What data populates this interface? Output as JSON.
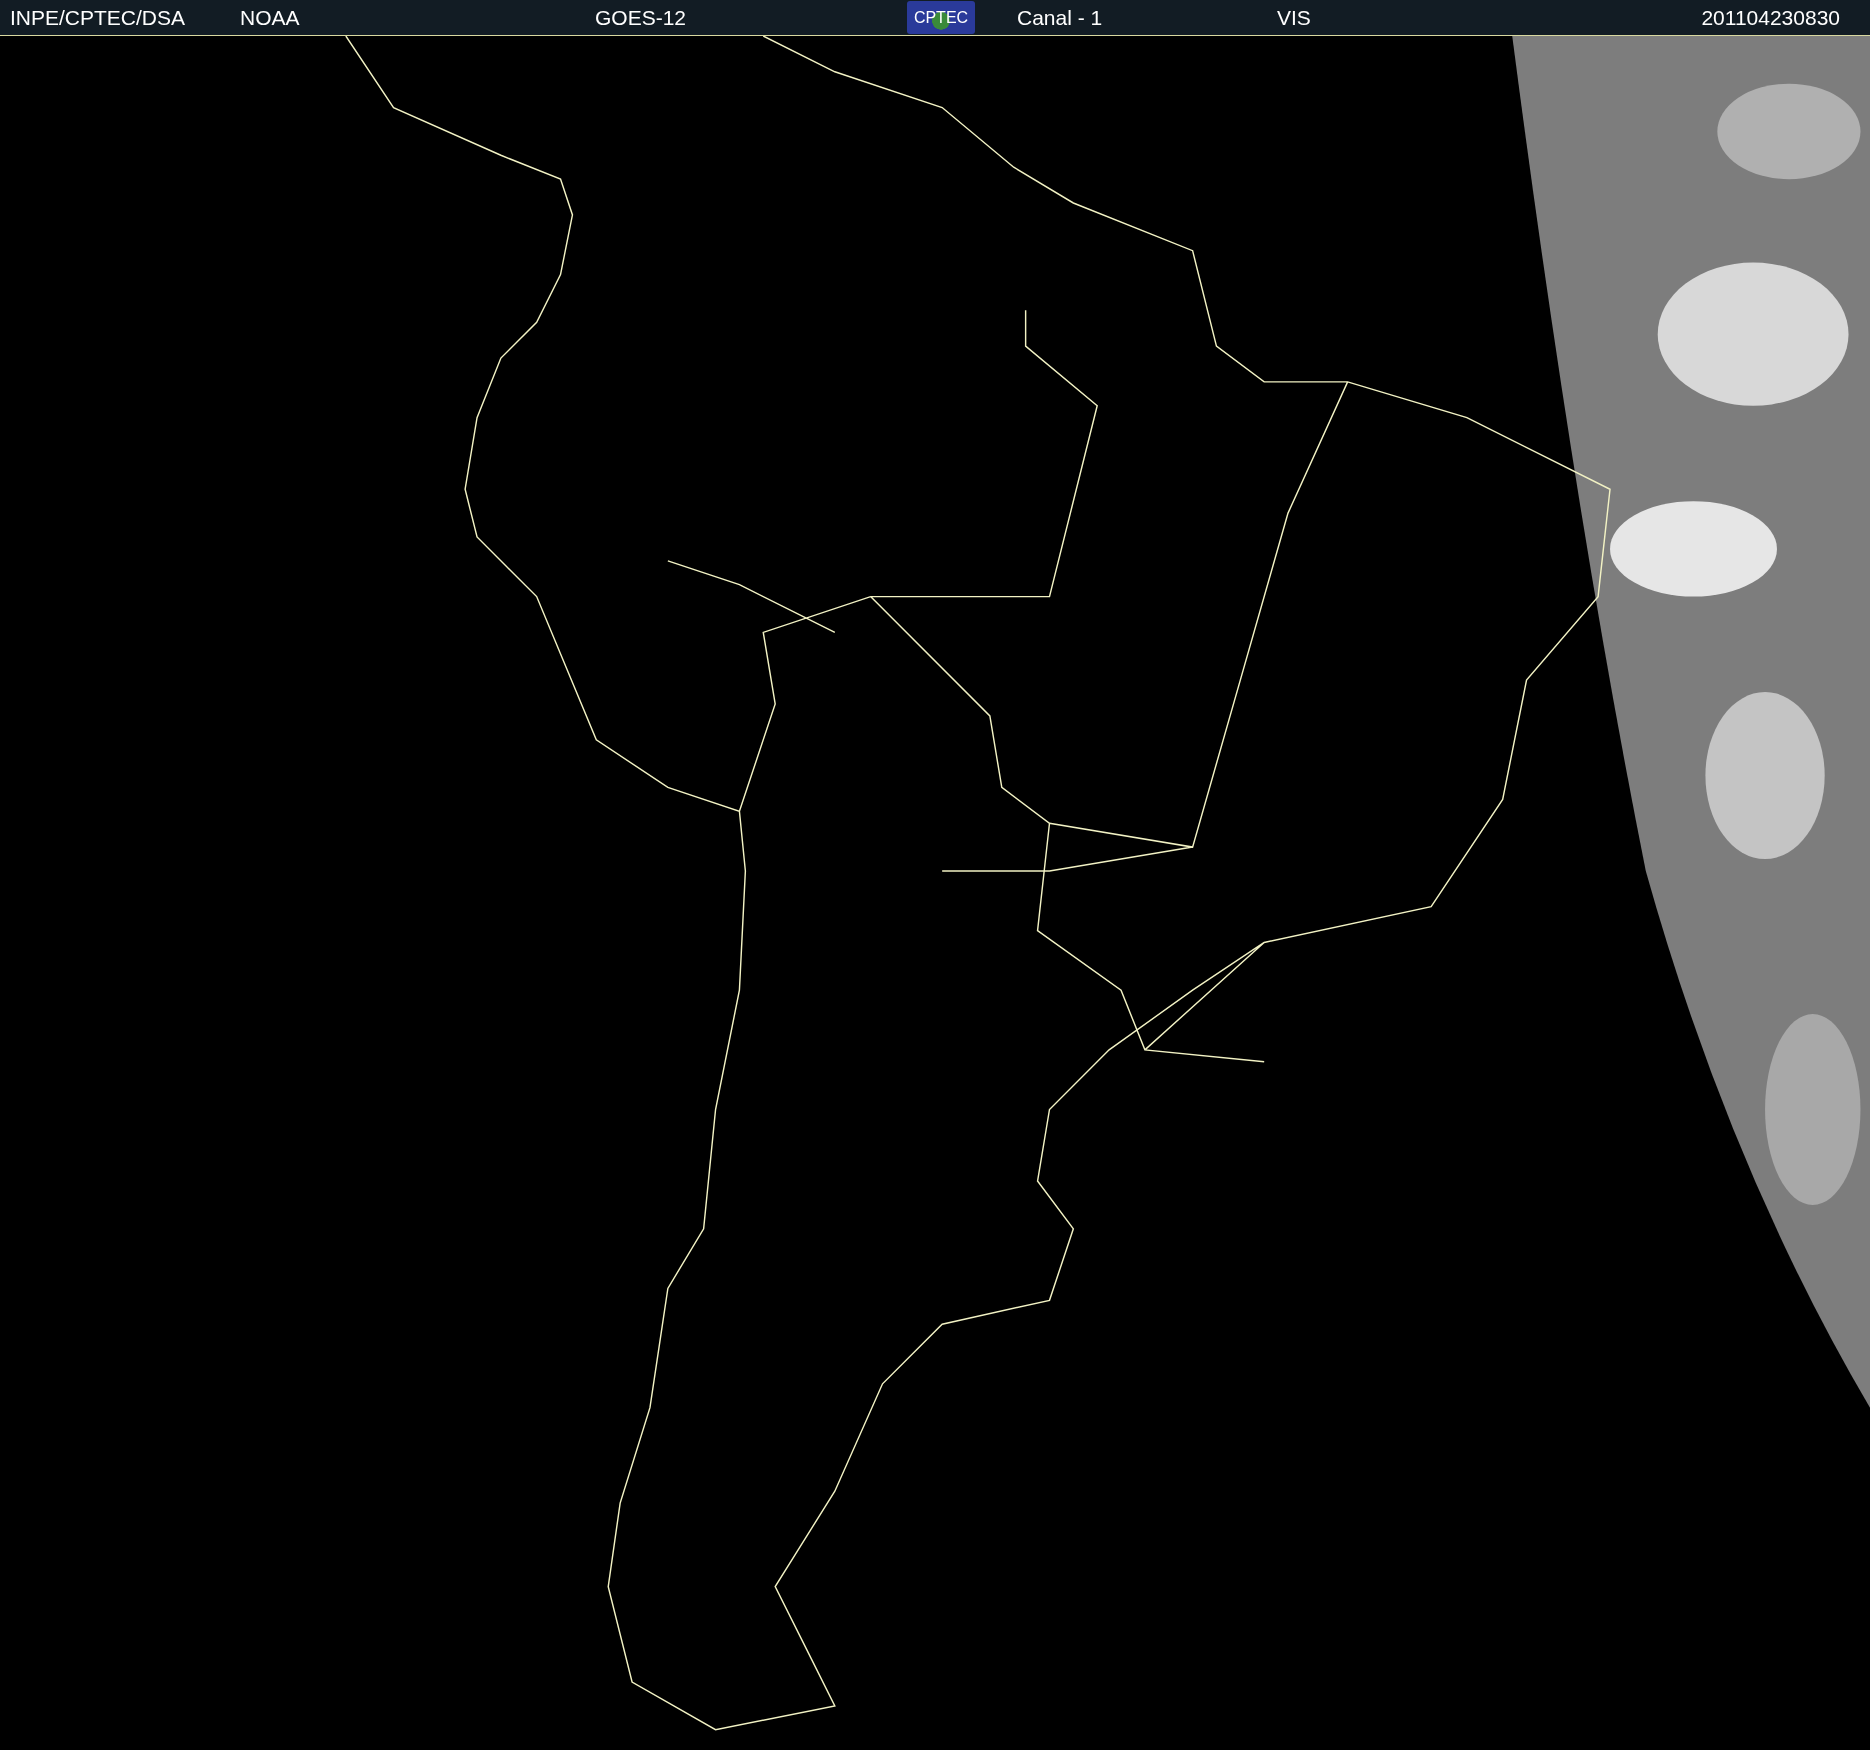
{
  "header": {
    "items": [
      {
        "kind": "text",
        "text": "INPE/CPTEC/DSA"
      },
      {
        "kind": "text",
        "text": "NOAA"
      },
      {
        "kind": "text",
        "text": "GOES-12"
      },
      {
        "kind": "logo",
        "text": "CPTEC"
      },
      {
        "kind": "text",
        "text": "Canal - 1"
      },
      {
        "kind": "text",
        "text": "VIS"
      },
      {
        "kind": "text",
        "text": "201104230830"
      }
    ]
  }
}
